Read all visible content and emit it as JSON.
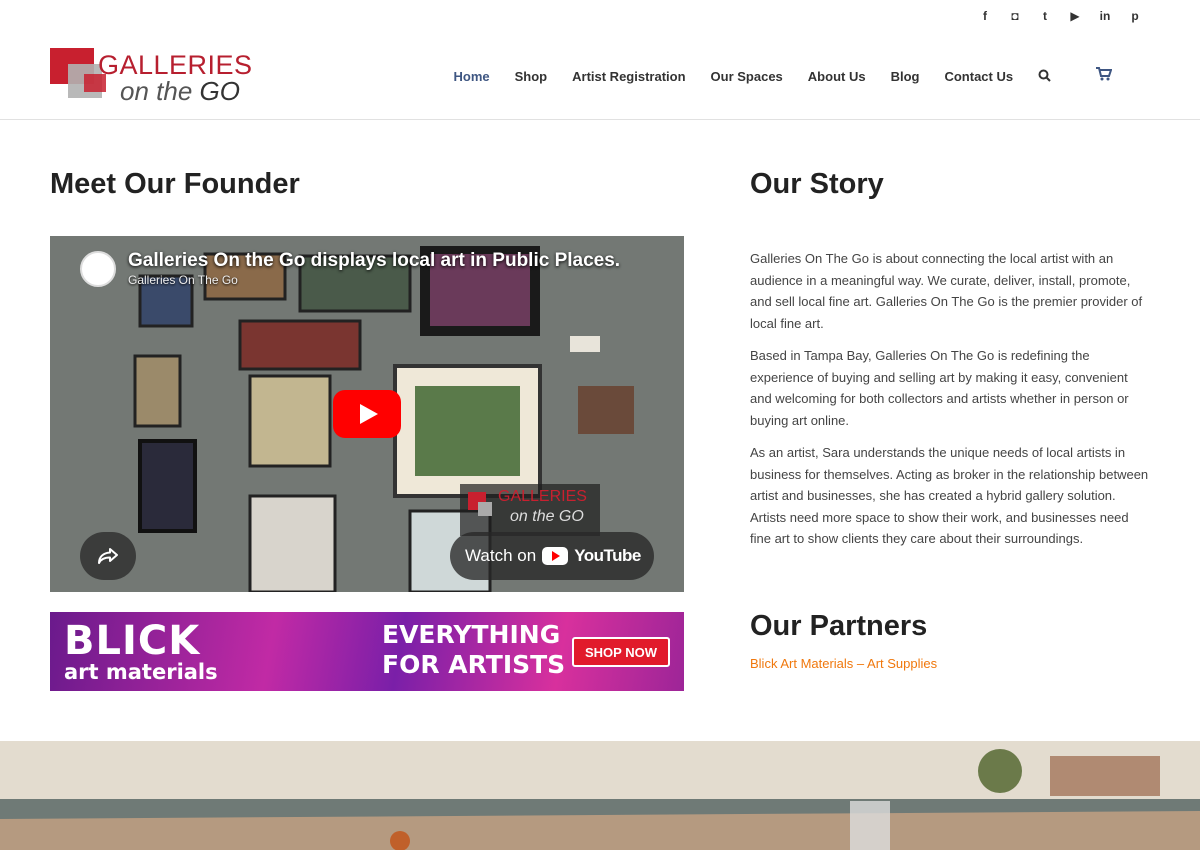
{
  "social": {
    "facebook": "f",
    "instagram": "◘",
    "twitter": "t",
    "youtube": "▶",
    "linkedin": "in",
    "pinterest": "p"
  },
  "logo": {
    "line1": "GALLERIES",
    "line2_a": "on the ",
    "line2_b": "GO"
  },
  "nav": {
    "items": [
      "Home",
      "Shop",
      "Artist Registration",
      "Our Spaces",
      "About Us",
      "Blog",
      "Contact Us"
    ],
    "active": "Home"
  },
  "left": {
    "heading": "Meet Our Founder",
    "video": {
      "title": "Galleries On the Go displays local art in Public Places.",
      "channel": "Galleries On The Go",
      "watch_label": "Watch on",
      "watch_brand": "YouTube",
      "overlay_logo_1": "GALLERIES",
      "overlay_logo_2": "on the GO"
    },
    "banner": {
      "brand": "BLICK",
      "brand_sub": "art materials",
      "line1": "EVERYTHING",
      "line2": "FOR ARTISTS",
      "cta": "SHOP NOW"
    }
  },
  "right": {
    "heading": "Our Story",
    "paragraphs": [
      "Galleries On The Go is about connecting the local artist with an audience in a meaningful way. We curate, deliver, install, promote, and sell local fine art. Galleries On The Go is the premier provider of local fine art.",
      "Based in Tampa Bay, Galleries On The Go is redefining the experience of buying and selling art by making it easy, convenient and welcoming for both collectors and artists whether in person or buying art online.",
      "As an artist, Sara understands the unique needs of local artists in business for themselves. Acting as broker in the relationship between artist and businesses, she has created a hybrid gallery solution. Artists need more space to show their work, and businesses need fine art to show clients they care about their surroundings."
    ],
    "partners_heading": "Our Partners",
    "partner_link": "Blick Art Materials – Art Supplies"
  }
}
